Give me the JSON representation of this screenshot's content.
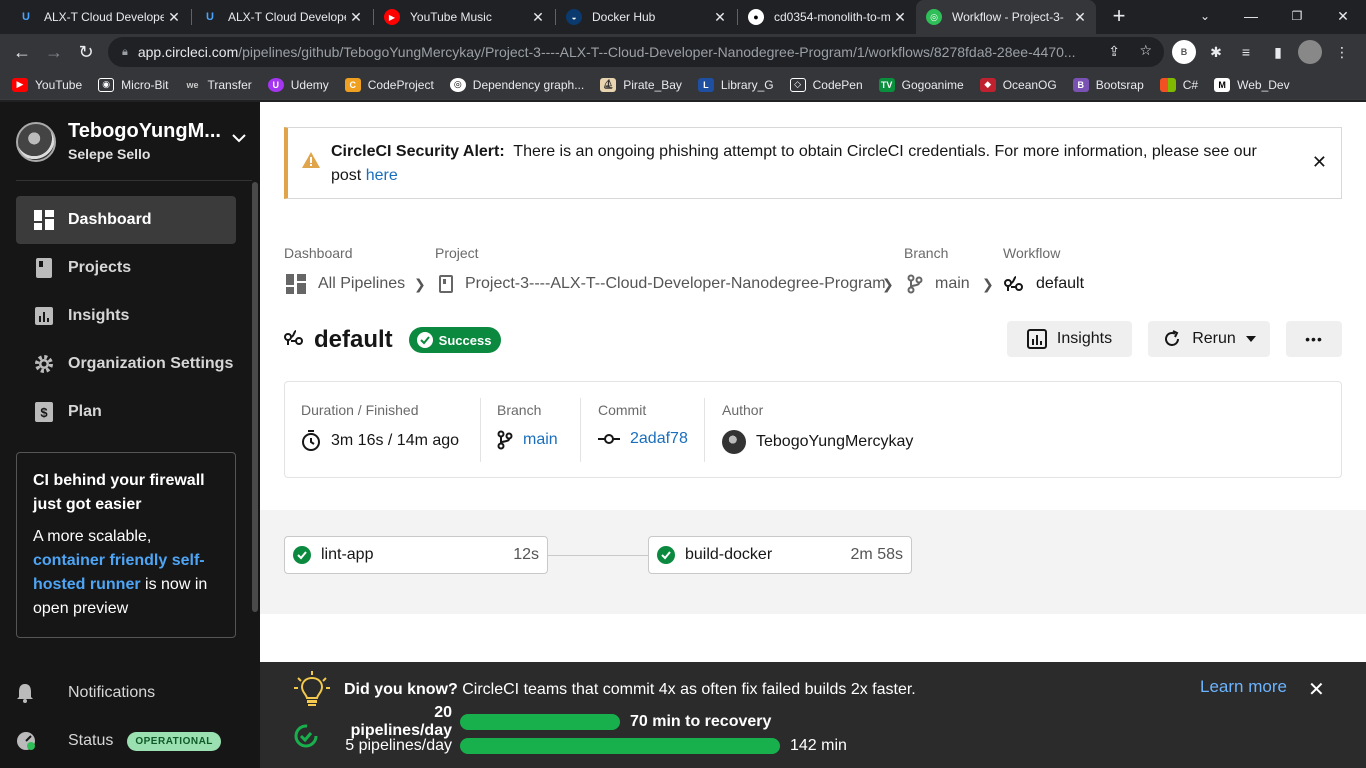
{
  "browser": {
    "tabs": [
      {
        "title": "ALX-T Cloud Develope",
        "icon": "udacity-icon"
      },
      {
        "title": "ALX-T Cloud Develope",
        "icon": "udacity-icon"
      },
      {
        "title": "YouTube Music",
        "icon": "youtube-music-icon"
      },
      {
        "title": "Docker Hub",
        "icon": "docker-icon"
      },
      {
        "title": "cd0354-monolith-to-m",
        "icon": "github-icon"
      },
      {
        "title": "Workflow - Project-3-",
        "icon": "circleci-icon"
      }
    ],
    "new_tab": "+",
    "url_host": "app.circleci.com",
    "url_path": "/pipelines/github/TebogoYungMercykay/Project-3----ALX-T--Cloud-Developer-Nanodegree-Program/1/workflows/8278fda8-28ee-4470...",
    "profile_initial": "B",
    "bookmarks": [
      "YouTube",
      "Micro-Bit",
      "Transfer",
      "Udemy",
      "CodeProject",
      "Dependency graph...",
      "Pirate_Bay",
      "Library_G",
      "CodePen",
      "Gogoanime",
      "OceanOG",
      "Bootsrap",
      "C#",
      "Web_Dev"
    ]
  },
  "sidebar": {
    "org_name": "TebogoYungM...",
    "user_name": "Selepe Sello",
    "items": [
      {
        "label": "Dashboard",
        "icon": "dashboard-icon"
      },
      {
        "label": "Projects",
        "icon": "projects-icon"
      },
      {
        "label": "Insights",
        "icon": "insights-icon"
      },
      {
        "label": "Organization Settings",
        "icon": "gear-icon"
      },
      {
        "label": "Plan",
        "icon": "dollar-icon"
      }
    ],
    "promo": {
      "heading": "CI behind your firewall just got easier",
      "text_before": "A more scalable,",
      "link": "container friendly self-hosted runner",
      "text_after": "is now in open preview"
    },
    "notifications": "Notifications",
    "status": "Status",
    "status_badge": "OPERATIONAL"
  },
  "alert": {
    "title": "CircleCI Security Alert:",
    "text": "There is an ongoing phishing attempt to obtain CircleCI credentials. For more information, please see our post",
    "link": "here"
  },
  "breadcrumb": {
    "dashboard_label": "Dashboard",
    "dashboard_value": "All Pipelines",
    "project_label": "Project",
    "project_value": "Project-3----ALX-T--Cloud-Developer-Nanodegree-Program",
    "branch_label": "Branch",
    "branch_value": "main",
    "workflow_label": "Workflow",
    "workflow_value": "default"
  },
  "workflow": {
    "name": "default",
    "status": "Success",
    "insights_label": "Insights",
    "rerun_label": "Rerun",
    "more_label": "•••"
  },
  "meta": {
    "duration_label": "Duration / Finished",
    "duration_value": "3m 16s / 14m ago",
    "branch_label": "Branch",
    "branch_value": "main",
    "commit_label": "Commit",
    "commit_value": "2adaf78",
    "author_label": "Author",
    "author_value": "TebogoYungMercykay"
  },
  "jobs": [
    {
      "name": "lint-app",
      "duration": "12s"
    },
    {
      "name": "build-docker",
      "duration": "2m 58s"
    }
  ],
  "tip": {
    "bold": "Did you know?",
    "text": "CircleCI teams that commit 4x as often fix failed builds 2x faster.",
    "row1_label": "20 pipelines/day",
    "row1_value": "70 min to recovery",
    "row2_label": "5 pipelines/day",
    "row2_value": "142 min",
    "learn_more": "Learn more",
    "close": "✕"
  },
  "colors": {
    "success": "#0b8a3f",
    "link": "#1a6fbd",
    "alert_border": "#e0a54b",
    "bar": "#18b04c"
  }
}
